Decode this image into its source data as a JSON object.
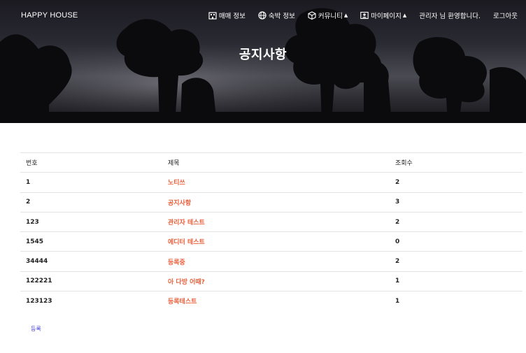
{
  "brand": "HAPPY HOUSE",
  "nav": {
    "items": [
      {
        "label": "매매 정보",
        "icon": "building-icon"
      },
      {
        "label": "숙박 정보",
        "icon": "globe-icon"
      },
      {
        "label": "커뮤니티",
        "icon": "box-icon",
        "dropdown": true
      },
      {
        "label": "마이페이지",
        "icon": "portrait-icon",
        "dropdown": true
      }
    ],
    "welcome": "관리자 님 환영합니다.",
    "logout": "로그아웃"
  },
  "hero": {
    "title": "공지사항"
  },
  "table": {
    "headers": [
      "번호",
      "제목",
      "조회수"
    ],
    "rows": [
      {
        "no": "1",
        "title": "노티쓰",
        "views": "2"
      },
      {
        "no": "2",
        "title": "공지사항",
        "views": "3"
      },
      {
        "no": "123",
        "title": "관리자 테스트",
        "views": "2"
      },
      {
        "no": "1545",
        "title": "에디터 테스트",
        "views": "0"
      },
      {
        "no": "34444",
        "title": "등록중",
        "views": "2"
      },
      {
        "no": "122221",
        "title": "아 다방 어때?",
        "views": "1"
      },
      {
        "no": "123123",
        "title": "등록테스트",
        "views": "1"
      }
    ]
  },
  "register_label": "등록",
  "colors": {
    "title_link": "#e8603c",
    "register_link": "#3b3bd4"
  }
}
